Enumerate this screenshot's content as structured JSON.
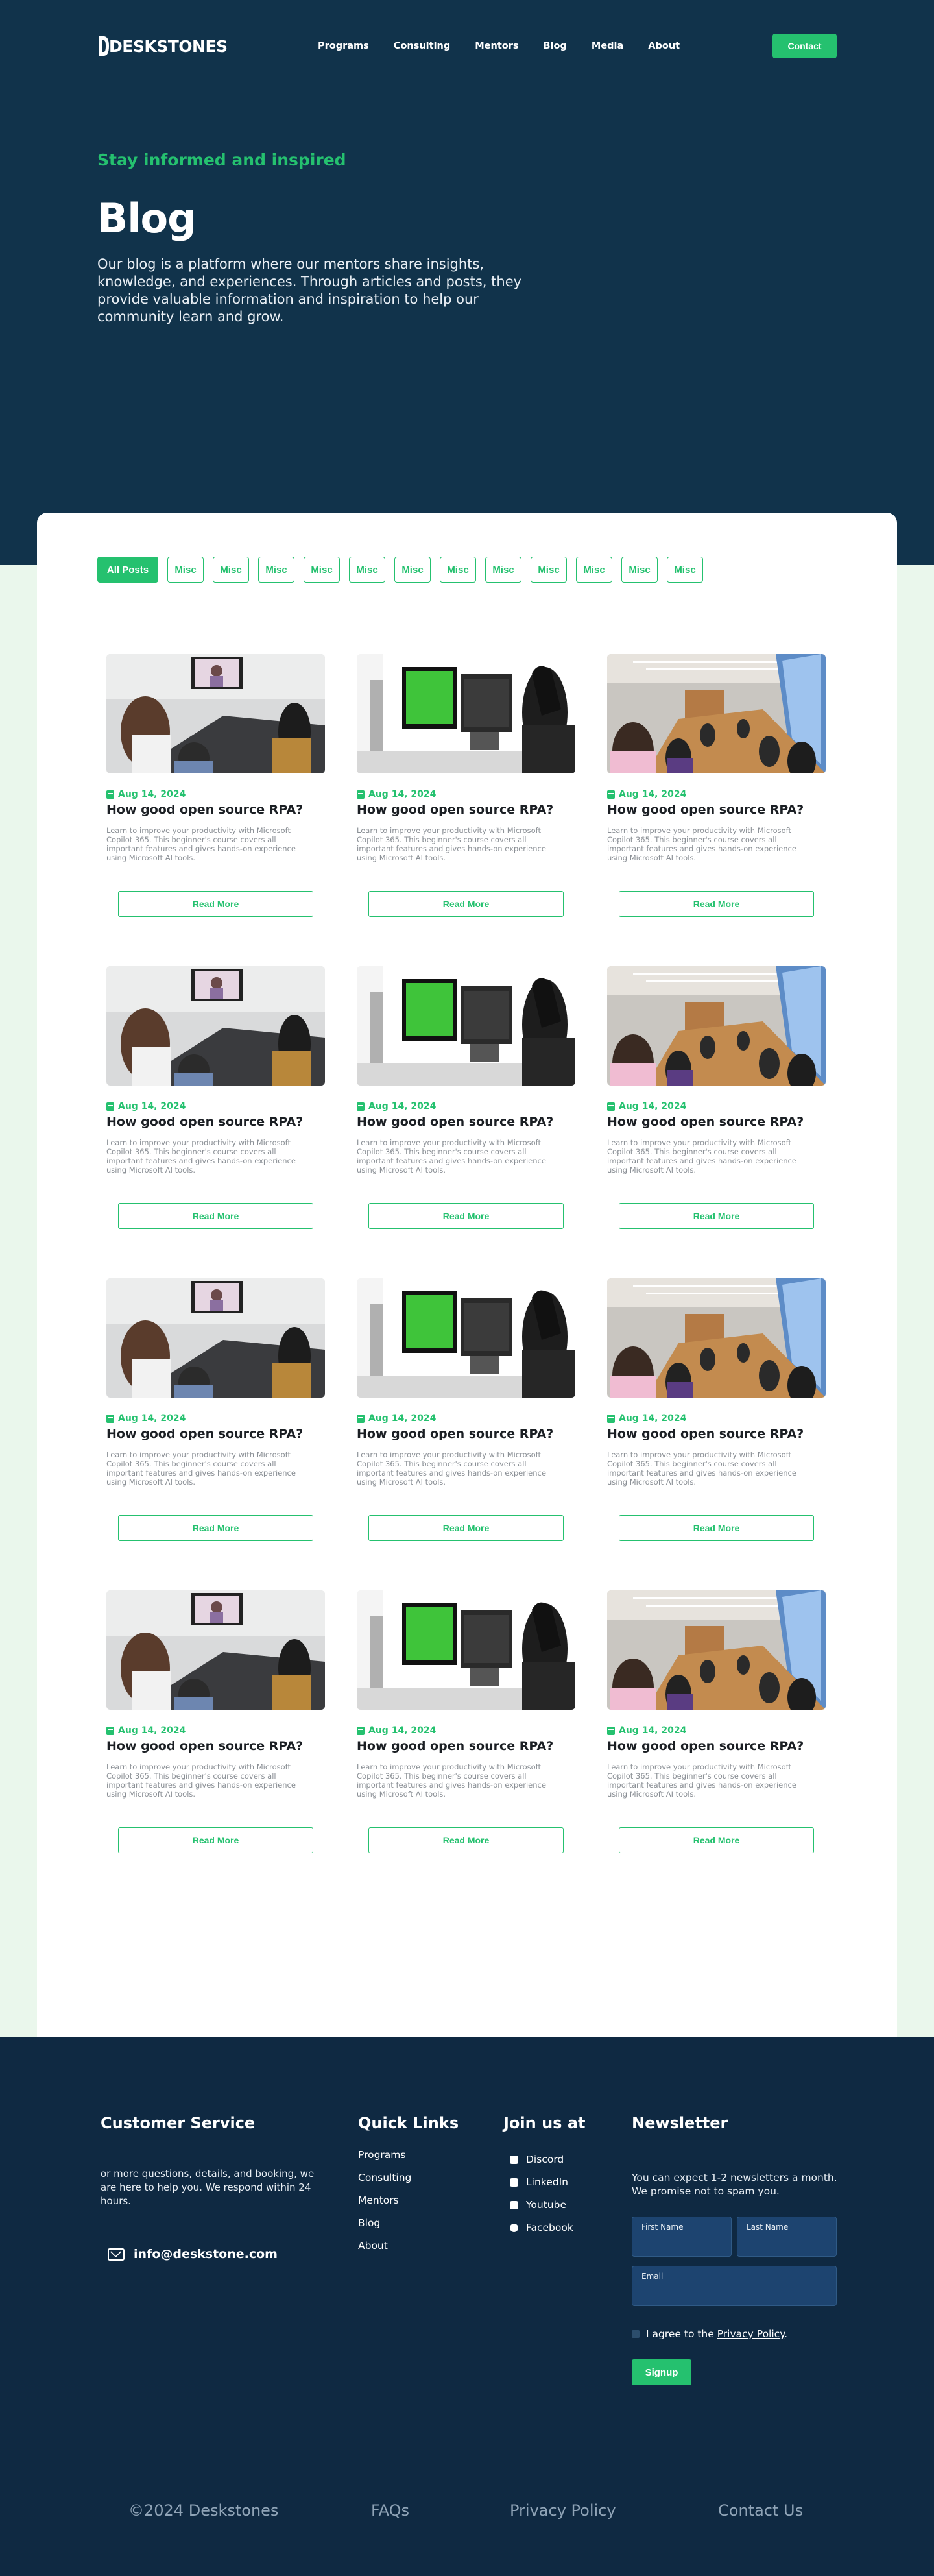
{
  "brand": {
    "name": "DESKSTONES"
  },
  "nav": {
    "links": [
      "Programs",
      "Consulting",
      "Mentors",
      "Blog",
      "Media",
      "About"
    ],
    "contact_label": "Contact"
  },
  "hero": {
    "eyebrow": "Stay informed and inspired",
    "title": "Blog",
    "description": "Our blog is a platform where our mentors share insights, knowledge, and experiences. Through articles and posts, they provide valuable information and inspiration to help our community learn and grow."
  },
  "filters": [
    "All Posts",
    "Misc",
    "Misc",
    "Misc",
    "Misc",
    "Misc",
    "Misc",
    "Misc",
    "Misc",
    "Misc",
    "Misc",
    "Misc",
    "Misc"
  ],
  "posts": [
    {
      "image": "video-conference-room",
      "date": "Aug 14, 2024",
      "title": "How good open source RPA?",
      "excerpt": "Learn to improve your productivity with Microsoft Copilot 365. This beginner's course covers all important features and gives hands-on experience using Microsoft AI tools.",
      "cta": "Read More"
    },
    {
      "image": "green-screen-monitors",
      "date": "Aug 14, 2024",
      "title": "How good open source RPA?",
      "excerpt": "Learn to improve your productivity with Microsoft Copilot 365. This beginner's course covers all important features and gives hands-on experience using Microsoft AI tools.",
      "cta": "Read More"
    },
    {
      "image": "meeting-room-table",
      "date": "Aug 14, 2024",
      "title": "How good open source RPA?",
      "excerpt": "Learn to improve your productivity with Microsoft Copilot 365. This beginner's course covers all important features and gives hands-on experience using Microsoft AI tools.",
      "cta": "Read More"
    },
    {
      "image": "video-conference-room",
      "date": "Aug 14, 2024",
      "title": "How good open source RPA?",
      "excerpt": "Learn to improve your productivity with Microsoft Copilot 365. This beginner's course covers all important features and gives hands-on experience using Microsoft AI tools.",
      "cta": "Read More"
    },
    {
      "image": "green-screen-monitors",
      "date": "Aug 14, 2024",
      "title": "How good open source RPA?",
      "excerpt": "Learn to improve your productivity with Microsoft Copilot 365. This beginner's course covers all important features and gives hands-on experience using Microsoft AI tools.",
      "cta": "Read More"
    },
    {
      "image": "meeting-room-table",
      "date": "Aug 14, 2024",
      "title": "How good open source RPA?",
      "excerpt": "Learn to improve your productivity with Microsoft Copilot 365. This beginner's course covers all important features and gives hands-on experience using Microsoft AI tools.",
      "cta": "Read More"
    },
    {
      "image": "video-conference-room",
      "date": "Aug 14, 2024",
      "title": "How good open source RPA?",
      "excerpt": "Learn to improve your productivity with Microsoft Copilot 365. This beginner's course covers all important features and gives hands-on experience using Microsoft AI tools.",
      "cta": "Read More"
    },
    {
      "image": "green-screen-monitors",
      "date": "Aug 14, 2024",
      "title": "How good open source RPA?",
      "excerpt": "Learn to improve your productivity with Microsoft Copilot 365. This beginner's course covers all important features and gives hands-on experience using Microsoft AI tools.",
      "cta": "Read More"
    },
    {
      "image": "meeting-room-table",
      "date": "Aug 14, 2024",
      "title": "How good open source RPA?",
      "excerpt": "Learn to improve your productivity with Microsoft Copilot 365. This beginner's course covers all important features and gives hands-on experience using Microsoft AI tools.",
      "cta": "Read More"
    },
    {
      "image": "video-conference-room",
      "date": "Aug 14, 2024",
      "title": "How good open source RPA?",
      "excerpt": "Learn to improve your productivity with Microsoft Copilot 365. This beginner's course covers all important features and gives hands-on experience using Microsoft AI tools.",
      "cta": "Read More"
    },
    {
      "image": "green-screen-monitors",
      "date": "Aug 14, 2024",
      "title": "How good open source RPA?",
      "excerpt": "Learn to improve your productivity with Microsoft Copilot 365. This beginner's course covers all important features and gives hands-on experience using Microsoft AI tools.",
      "cta": "Read More"
    },
    {
      "image": "meeting-room-table",
      "date": "Aug 14, 2024",
      "title": "How good open source RPA?",
      "excerpt": "Learn to improve your productivity with Microsoft Copilot 365. This beginner's course covers all important features and gives hands-on experience using Microsoft AI tools.",
      "cta": "Read More"
    }
  ],
  "footer": {
    "customer_service": {
      "heading": "Customer Service",
      "text": "or more questions, details, and booking, we are here to help you. We respond within 24 hours.",
      "email": "info@deskstone.com"
    },
    "quick_links": {
      "heading": "Quick Links",
      "links": [
        "Programs",
        "Consulting",
        "Mentors",
        "Blog",
        "About"
      ]
    },
    "join": {
      "heading": "Join us at",
      "items": [
        {
          "label": "Discord",
          "icon": "discord-icon"
        },
        {
          "label": "LinkedIn",
          "icon": "linkedin-icon"
        },
        {
          "label": "Youtube",
          "icon": "youtube-icon"
        },
        {
          "label": "Facebook",
          "icon": "facebook-icon"
        }
      ]
    },
    "newsletter": {
      "heading": "Newsletter",
      "text": "You can expect 1-2 newsletters a month. We promise not to spam you.",
      "first_name_label": "First Name",
      "last_name_label": "Last Name",
      "email_label": "Email",
      "agree_text": "I agree to the",
      "privacy_link": "Privacy Policy",
      "agree_suffix": ".",
      "signup_label": "Signup"
    },
    "bottom": {
      "copyright": "©2024 Deskstones",
      "faqs": "FAQs",
      "privacy": "Privacy Policy",
      "contact": "Contact Us"
    }
  },
  "colors": {
    "navy": "#11334b",
    "dark_navy": "#0f2942",
    "accent_green": "#25c16f",
    "mint": "#eaf7ec"
  }
}
